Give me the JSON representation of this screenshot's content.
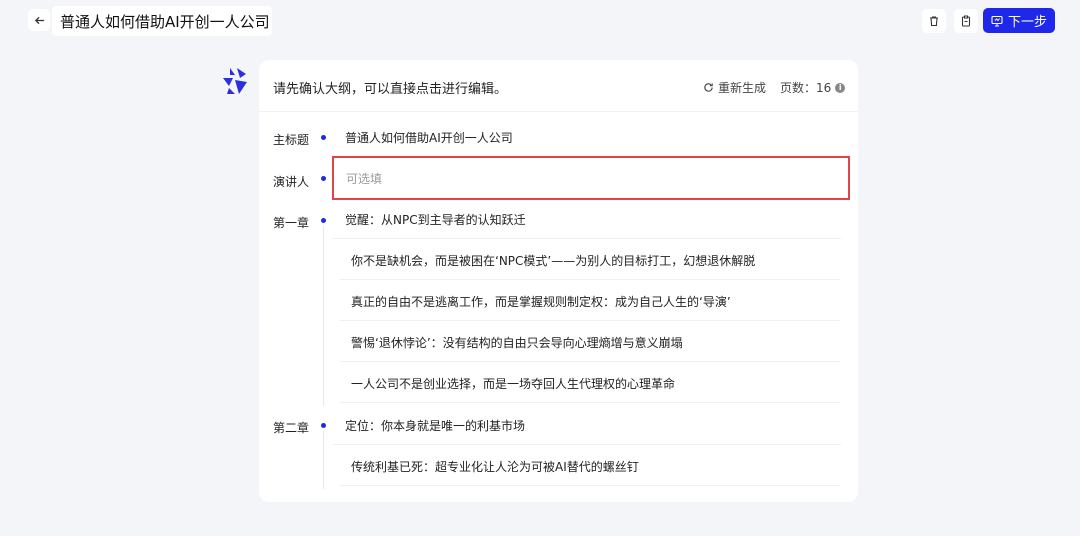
{
  "header": {
    "back_icon": "arrow-left-icon",
    "title": "普通人如何借助AI开创一人公司",
    "delete_icon": "trash-icon",
    "save_icon": "clipboard-icon",
    "next_label": "下一步",
    "next_icon": "presentation-icon",
    "accent": "#1f28e8"
  },
  "card": {
    "prompt": "请先确认大纲，可以直接点击进行编辑。",
    "regenerate_label": "重新生成",
    "pages_label": "页数：16"
  },
  "outline": {
    "main_title_label": "主标题",
    "main_title_value": "普通人如何借助AI开创一人公司",
    "speaker_label": "演讲人",
    "speaker_placeholder": "可选填",
    "chapters": [
      {
        "label": "第一章",
        "title": "觉醒：从NPC到主导者的认知跃迁",
        "items": [
          "你不是缺机会，而是被困在‘NPC模式’——为别人的目标打工，幻想退休解脱",
          "真正的自由不是逃离工作，而是掌握规则制定权：成为自己人生的‘导演’",
          "警惕‘退休悖论’：没有结构的自由只会导向心理熵增与意义崩塌",
          "一人公司不是创业选择，而是一场夺回人生代理权的心理革命"
        ]
      },
      {
        "label": "第二章",
        "title": "定位：你本身就是唯一的利基市场",
        "items": [
          "传统利基已死：超专业化让人沦为可被AI替代的螺丝钉"
        ]
      }
    ]
  }
}
